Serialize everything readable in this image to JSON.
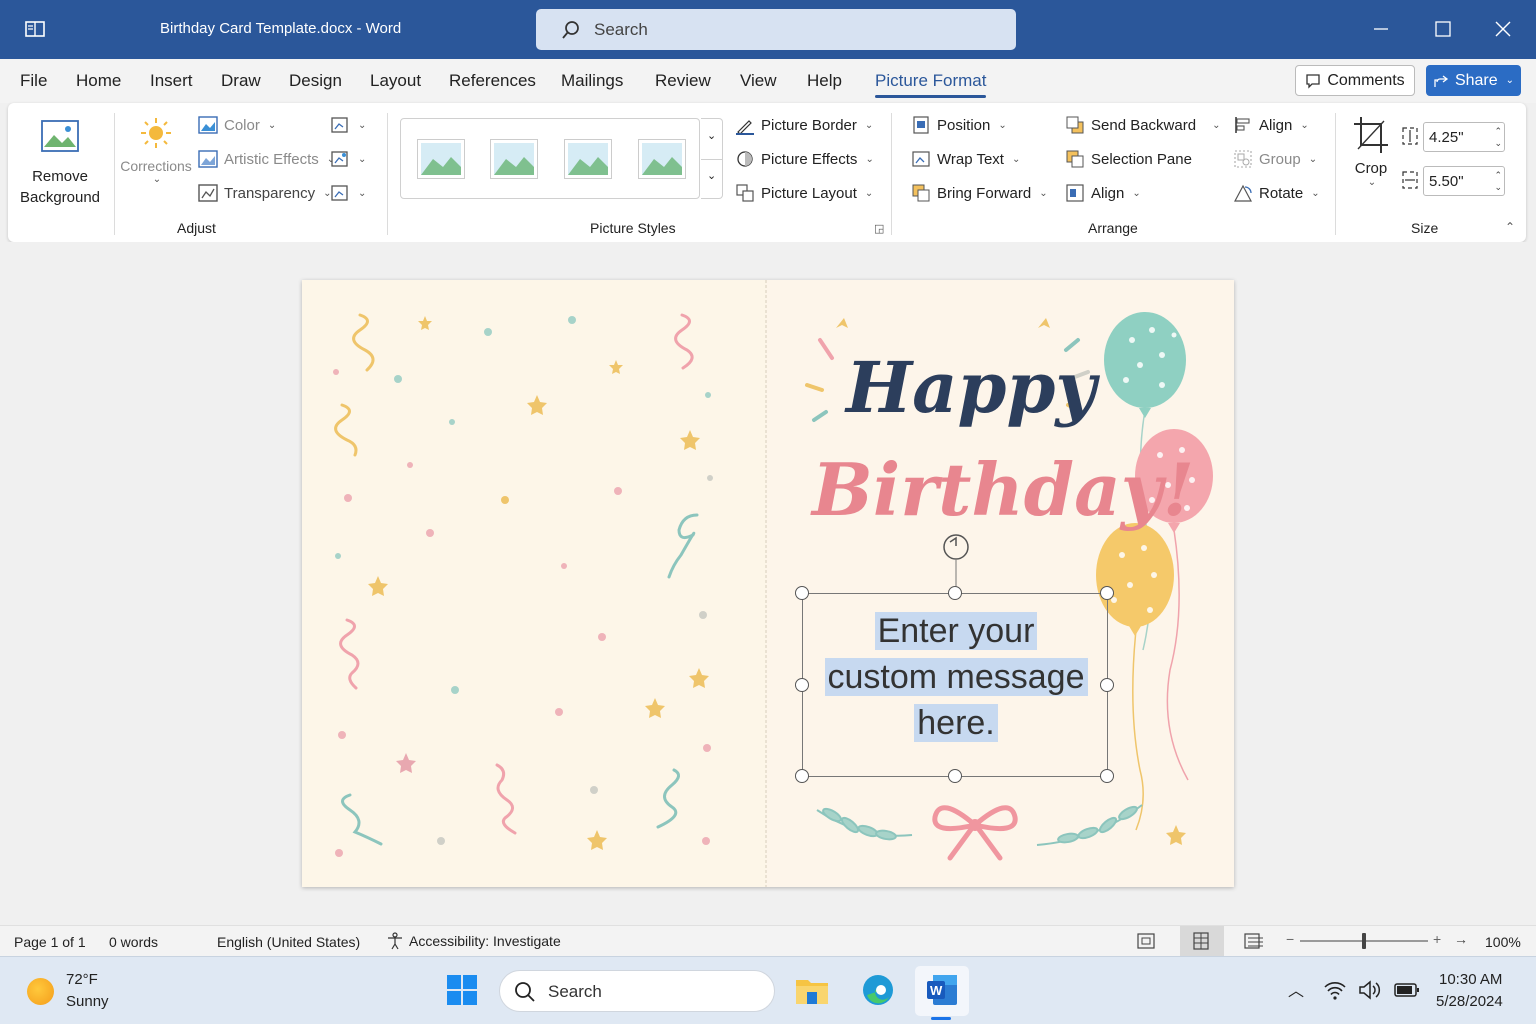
{
  "window": {
    "title": "Birthday Card Template.docx - Word",
    "search_placeholder": "Search"
  },
  "tabs": [
    {
      "label": "File"
    },
    {
      "label": "Home"
    },
    {
      "label": "Insert"
    },
    {
      "label": "Draw"
    },
    {
      "label": "Design"
    },
    {
      "label": "Layout"
    },
    {
      "label": "References"
    },
    {
      "label": "Mailings"
    },
    {
      "label": "Review"
    },
    {
      "label": "View"
    },
    {
      "label": "Help"
    },
    {
      "label": "Picture Format"
    }
  ],
  "active_tab": "Picture Format",
  "header_buttons": {
    "comments": "Comments",
    "share": "Share"
  },
  "ribbon": {
    "adjust": {
      "remove_bg_line1": "Remove",
      "remove_bg_line2": "Background",
      "corrections": "Corrections",
      "color": "Color",
      "artistic_effects": "Artistic Effects",
      "transparency": "Transparency",
      "group_label": "Adjust"
    },
    "picture_styles": {
      "picture_border": "Picture Border",
      "picture_effects": "Picture Effects",
      "picture_layout": "Picture Layout",
      "group_label": "Picture Styles"
    },
    "arrange": {
      "position": "Position",
      "wrap_text": "Wrap Text",
      "bring_forward": "Bring Forward",
      "send_backward": "Send Backward",
      "selection_pane": "Selection Pane",
      "align_mid": "Align",
      "align": "Align",
      "group": "Group",
      "rotate": "Rotate",
      "group_label": "Arrange"
    },
    "size": {
      "crop": "Crop",
      "height": "4.25\"",
      "width": "5.50\"",
      "group_label": "Size"
    }
  },
  "card": {
    "headline_1": "Happy",
    "headline_2": "Birthday!",
    "message_lines": [
      "Enter your",
      "custom message",
      "here."
    ]
  },
  "statusbar": {
    "page": "Page 1 of 1",
    "words": "0 words",
    "language": "English (United States)",
    "accessibility": "Accessibility: Investigate",
    "zoom": "100%",
    "zoom_level": 1.0
  },
  "taskbar": {
    "weather_temp": "72°F",
    "weather_desc": "Sunny",
    "search": "Search",
    "time": "10:30 AM",
    "date": "5/28/2024"
  },
  "colors": {
    "titlebar": "#2b579a",
    "accent": "#2b6cc4",
    "card_bg": "#fdf6e8",
    "happy_text": "#2c3e5c",
    "birthday_text": "#e8868f",
    "selection": "#c7d9f0"
  }
}
